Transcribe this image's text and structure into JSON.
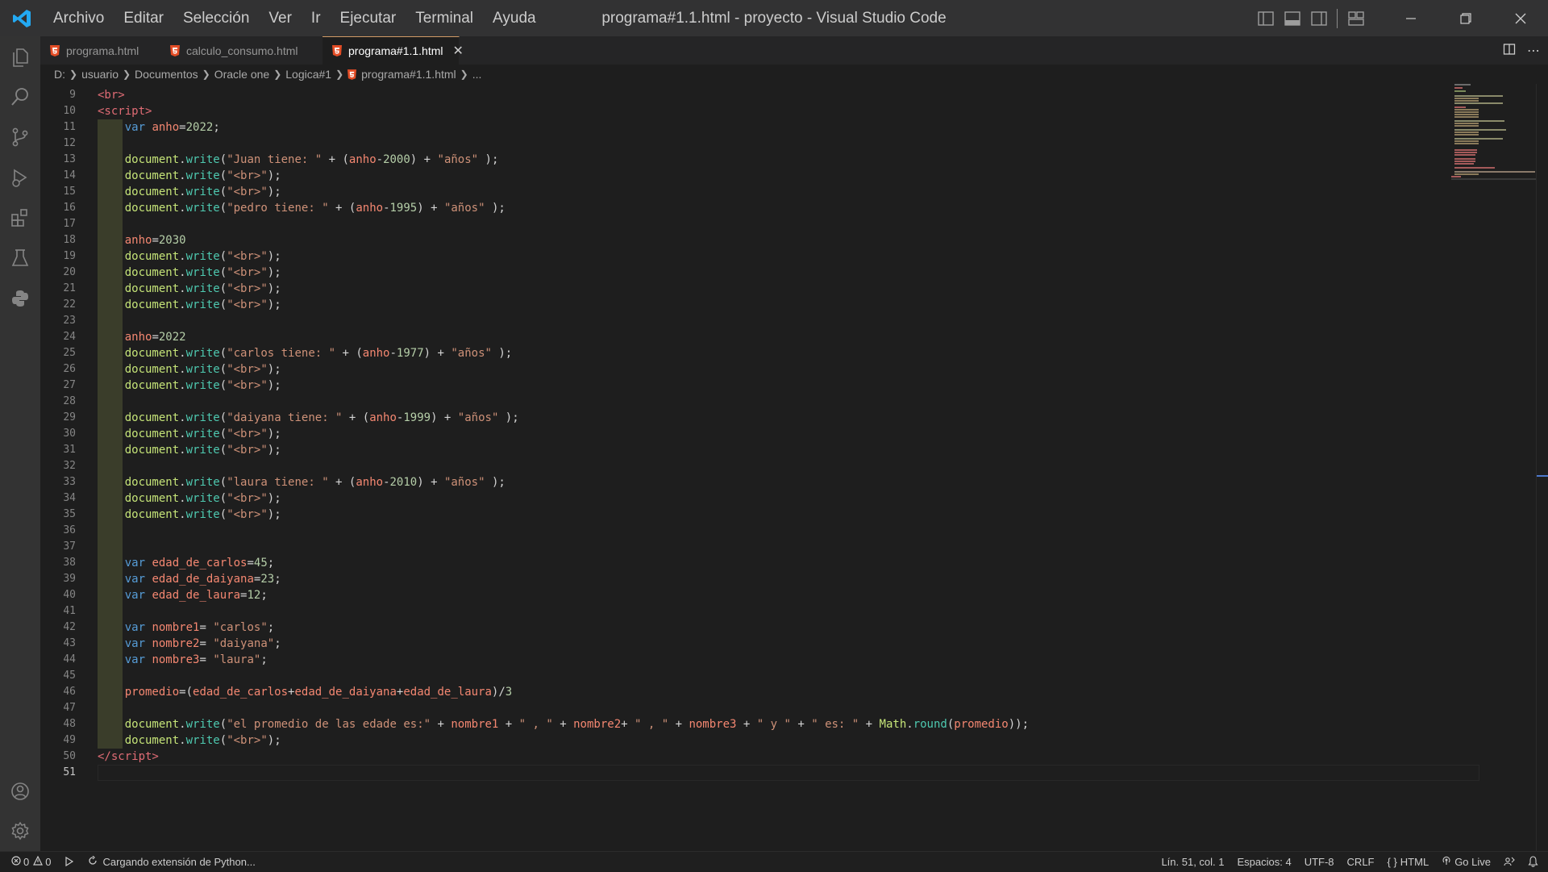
{
  "titlebar": {
    "menu": [
      "Archivo",
      "Editar",
      "Selección",
      "Ver",
      "Ir",
      "Ejecutar",
      "Terminal",
      "Ayuda"
    ],
    "window_title": "programa#1.1.html - proyecto - Visual Studio Code"
  },
  "tabs": [
    {
      "label": "programa.html",
      "active": false
    },
    {
      "label": "calculo_consumo.html",
      "active": false
    },
    {
      "label": "programa#1.1.html",
      "active": true
    }
  ],
  "breadcrumb": [
    "D:",
    "usuario",
    "Documentos",
    "Oracle one",
    "Logica#1",
    "programa#1.1.html",
    "..."
  ],
  "editor": {
    "current_line": 51,
    "lines": [
      {
        "n": 9,
        "html": "<span class=\"tag\">&lt;br&gt;</span>",
        "guide": false
      },
      {
        "n": 10,
        "html": "<span class=\"tag\">&lt;script&gt;</span>",
        "guide": false
      },
      {
        "n": 11,
        "html": "    <span class=\"kw\">var</span> <span class=\"var\">anho</span>=<span class=\"num\">2022</span>;",
        "guide": true
      },
      {
        "n": 12,
        "html": "",
        "guide": true
      },
      {
        "n": 13,
        "html": "    <span class=\"obj\">document</span>.<span class=\"fn\">write</span>(<span class=\"str\">\"Juan tiene: \"</span> + (<span class=\"var\">anho</span>-<span class=\"num\">2000</span>) + <span class=\"str\">\"años\"</span> );",
        "guide": true
      },
      {
        "n": 14,
        "html": "    <span class=\"obj\">document</span>.<span class=\"fn\">write</span>(<span class=\"str\">\"&lt;br&gt;\"</span>);",
        "guide": true
      },
      {
        "n": 15,
        "html": "    <span class=\"obj\">document</span>.<span class=\"fn\">write</span>(<span class=\"str\">\"&lt;br&gt;\"</span>);",
        "guide": true
      },
      {
        "n": 16,
        "html": "    <span class=\"obj\">document</span>.<span class=\"fn\">write</span>(<span class=\"str\">\"pedro tiene: \"</span> + (<span class=\"var\">anho</span>-<span class=\"num\">1995</span>) + <span class=\"str\">\"años\"</span> );",
        "guide": true
      },
      {
        "n": 17,
        "html": "",
        "guide": true
      },
      {
        "n": 18,
        "html": "    <span class=\"var\">anho</span>=<span class=\"num\">2030</span>",
        "guide": true
      },
      {
        "n": 19,
        "html": "    <span class=\"obj\">document</span>.<span class=\"fn\">write</span>(<span class=\"str\">\"&lt;br&gt;\"</span>);",
        "guide": true
      },
      {
        "n": 20,
        "html": "    <span class=\"obj\">document</span>.<span class=\"fn\">write</span>(<span class=\"str\">\"&lt;br&gt;\"</span>);",
        "guide": true
      },
      {
        "n": 21,
        "html": "    <span class=\"obj\">document</span>.<span class=\"fn\">write</span>(<span class=\"str\">\"&lt;br&gt;\"</span>);",
        "guide": true
      },
      {
        "n": 22,
        "html": "    <span class=\"obj\">document</span>.<span class=\"fn\">write</span>(<span class=\"str\">\"&lt;br&gt;\"</span>);",
        "guide": true
      },
      {
        "n": 23,
        "html": "",
        "guide": true
      },
      {
        "n": 24,
        "html": "    <span class=\"var\">anho</span>=<span class=\"num\">2022</span>",
        "guide": true
      },
      {
        "n": 25,
        "html": "    <span class=\"obj\">document</span>.<span class=\"fn\">write</span>(<span class=\"str\">\"carlos tiene: \"</span> + (<span class=\"var\">anho</span>-<span class=\"num\">1977</span>) + <span class=\"str\">\"años\"</span> );",
        "guide": true
      },
      {
        "n": 26,
        "html": "    <span class=\"obj\">document</span>.<span class=\"fn\">write</span>(<span class=\"str\">\"&lt;br&gt;\"</span>);",
        "guide": true
      },
      {
        "n": 27,
        "html": "    <span class=\"obj\">document</span>.<span class=\"fn\">write</span>(<span class=\"str\">\"&lt;br&gt;\"</span>);",
        "guide": true
      },
      {
        "n": 28,
        "html": "",
        "guide": true
      },
      {
        "n": 29,
        "html": "    <span class=\"obj\">document</span>.<span class=\"fn\">write</span>(<span class=\"str\">\"daiyana tiene: \"</span> + (<span class=\"var\">anho</span>-<span class=\"num\">1999</span>) + <span class=\"str\">\"años\"</span> );",
        "guide": true
      },
      {
        "n": 30,
        "html": "    <span class=\"obj\">document</span>.<span class=\"fn\">write</span>(<span class=\"str\">\"&lt;br&gt;\"</span>);",
        "guide": true
      },
      {
        "n": 31,
        "html": "    <span class=\"obj\">document</span>.<span class=\"fn\">write</span>(<span class=\"str\">\"&lt;br&gt;\"</span>);",
        "guide": true
      },
      {
        "n": 32,
        "html": "",
        "guide": true
      },
      {
        "n": 33,
        "html": "    <span class=\"obj\">document</span>.<span class=\"fn\">write</span>(<span class=\"str\">\"laura tiene: \"</span> + (<span class=\"var\">anho</span>-<span class=\"num\">2010</span>) + <span class=\"str\">\"años\"</span> );",
        "guide": true
      },
      {
        "n": 34,
        "html": "    <span class=\"obj\">document</span>.<span class=\"fn\">write</span>(<span class=\"str\">\"&lt;br&gt;\"</span>);",
        "guide": true
      },
      {
        "n": 35,
        "html": "    <span class=\"obj\">document</span>.<span class=\"fn\">write</span>(<span class=\"str\">\"&lt;br&gt;\"</span>);",
        "guide": true
      },
      {
        "n": 36,
        "html": "",
        "guide": true
      },
      {
        "n": 37,
        "html": "",
        "guide": true
      },
      {
        "n": 38,
        "html": "    <span class=\"kw\">var</span> <span class=\"var\">edad_de_carlos</span>=<span class=\"num\">45</span>;",
        "guide": true
      },
      {
        "n": 39,
        "html": "    <span class=\"kw\">var</span> <span class=\"var\">edad_de_daiyana</span>=<span class=\"num\">23</span>;",
        "guide": true
      },
      {
        "n": 40,
        "html": "    <span class=\"kw\">var</span> <span class=\"var\">edad_de_laura</span>=<span class=\"num\">12</span>;",
        "guide": true
      },
      {
        "n": 41,
        "html": "",
        "guide": true
      },
      {
        "n": 42,
        "html": "    <span class=\"kw\">var</span> <span class=\"var\">nombre1</span>= <span class=\"str\">\"carlos\"</span>;",
        "guide": true
      },
      {
        "n": 43,
        "html": "    <span class=\"kw\">var</span> <span class=\"var\">nombre2</span>= <span class=\"str\">\"daiyana\"</span>;",
        "guide": true
      },
      {
        "n": 44,
        "html": "    <span class=\"kw\">var</span> <span class=\"var\">nombre3</span>= <span class=\"str\">\"laura\"</span>;",
        "guide": true
      },
      {
        "n": 45,
        "html": "",
        "guide": true
      },
      {
        "n": 46,
        "html": "    <span class=\"var\">promedio</span>=(<span class=\"var\">edad_de_carlos</span>+<span class=\"var\">edad_de_daiyana</span>+<span class=\"var\">edad_de_laura</span>)/<span class=\"num\">3</span>",
        "guide": true
      },
      {
        "n": 47,
        "html": "",
        "guide": true
      },
      {
        "n": 48,
        "html": "    <span class=\"obj\">document</span>.<span class=\"fn\">write</span>(<span class=\"str\">\"el promedio de las edade es:\"</span> + <span class=\"var\">nombre1</span> + <span class=\"str\">\" , \"</span> + <span class=\"var\">nombre2</span>+ <span class=\"str\">\" , \"</span> + <span class=\"var\">nombre3</span> + <span class=\"str\">\" y \"</span> + <span class=\"str\">\" es: \"</span> + <span class=\"obj\">Math</span>.<span class=\"fn\">round</span>(<span class=\"var\">promedio</span>));",
        "guide": true
      },
      {
        "n": 49,
        "html": "    <span class=\"obj\">document</span>.<span class=\"fn\">write</span>(<span class=\"str\">\"&lt;br&gt;\"</span>);",
        "guide": true
      },
      {
        "n": 50,
        "html": "<span class=\"tag\">&lt;/script&gt;</span>",
        "guide": false
      },
      {
        "n": 51,
        "html": "",
        "guide": false
      }
    ]
  },
  "statusbar": {
    "errors": "0",
    "warnings": "0",
    "loading": "Cargando extensión de Python...",
    "position": "Lín. 51, col. 1",
    "spaces": "Espacios: 4",
    "encoding": "UTF-8",
    "eol": "CRLF",
    "language": "HTML",
    "golive": "Go Live"
  },
  "colors": {
    "titlebar_bg": "#323233",
    "activitybar_bg": "#333333",
    "editor_bg": "#1e1e1e",
    "vscode_blue": "#23a9f2",
    "html_orange": "#e44d26"
  }
}
